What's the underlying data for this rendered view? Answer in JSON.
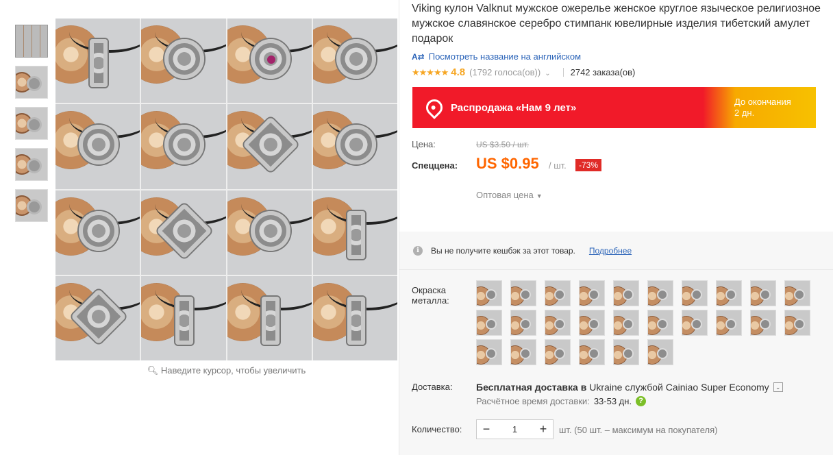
{
  "gallery": {
    "thumbnails": [
      "thumb-grid",
      "thumb-1",
      "thumb-2",
      "thumb-3",
      "thumb-4"
    ],
    "zoom_hint": "Наведите курсор, чтобы увеличить",
    "zoom_icon": "magnifier-icon"
  },
  "product": {
    "title": "Viking кулон Valknut мужское ожерелье женское круглое языческое религиозное мужское славянское серебро стимпанк ювелирные изделия тибетский амулет подарок",
    "translate_link": "Посмотреть название на английском",
    "translate_icon": "translate-icon",
    "rating_value": "4.8",
    "stars": "★★★★★",
    "votes": "(1792 голоса(ов))",
    "orders": "2742 заказа(ов)"
  },
  "banner": {
    "sale_name": "Распродажа «Нам 9 лет»",
    "countdown_label": "До окончания",
    "countdown_value": "2 дн.",
    "color_red": "#f11a29",
    "color_yellow": "#f7c100"
  },
  "pricing": {
    "price_label": "Цена:",
    "old_price": "US $3.50 / шт.",
    "special_label": "Спеццена:",
    "new_price": "US $0.95",
    "per_unit": "/ шт.",
    "discount": "-73%",
    "wholesale": "Оптовая цена",
    "accent_color": "#ff6600"
  },
  "cashback": {
    "text": "Вы не получите кешбэк за этот товар.",
    "link": "Подробнее"
  },
  "options": {
    "color_label": "Окраска металла:",
    "swatch_count": 26
  },
  "shipping": {
    "label": "Доставка:",
    "text_bold": "Бесплатная доставка в",
    "text_rest": "Ukraine службой Cainiao Super Economy",
    "eta_label": "Расчётное время доставки:",
    "eta_value": "33-53 дн."
  },
  "quantity": {
    "label": "Количество:",
    "value": "1",
    "minus": "−",
    "plus": "+",
    "note": "шт. (50 шт. – максимум на покупателя)"
  }
}
